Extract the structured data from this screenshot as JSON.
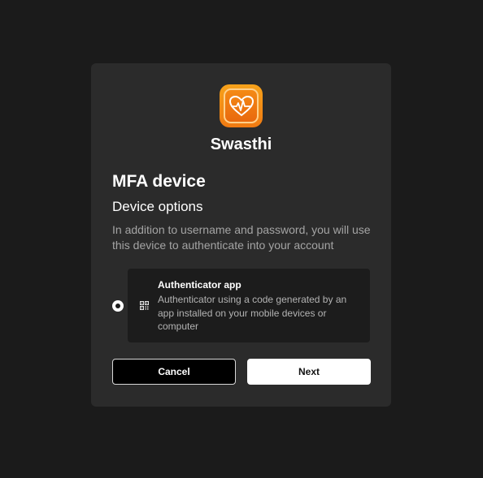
{
  "app": {
    "brand_name": "Swasthi",
    "logo_icon": "heart-pulse-icon",
    "colors": {
      "background": "#1b1b1b",
      "card": "#2b2b2b",
      "accent": "#f08a17"
    }
  },
  "mfa": {
    "title": "MFA device",
    "subtitle": "Device options",
    "description": "In addition to username and password, you will use this device to authenticate into your account",
    "options": [
      {
        "label": "Authenticator app",
        "description": "Authenticator using a code generated by an app installed on your mobile devices or computer",
        "icon": "qr-code-icon",
        "selected": true
      }
    ]
  },
  "actions": {
    "cancel_label": "Cancel",
    "next_label": "Next"
  }
}
